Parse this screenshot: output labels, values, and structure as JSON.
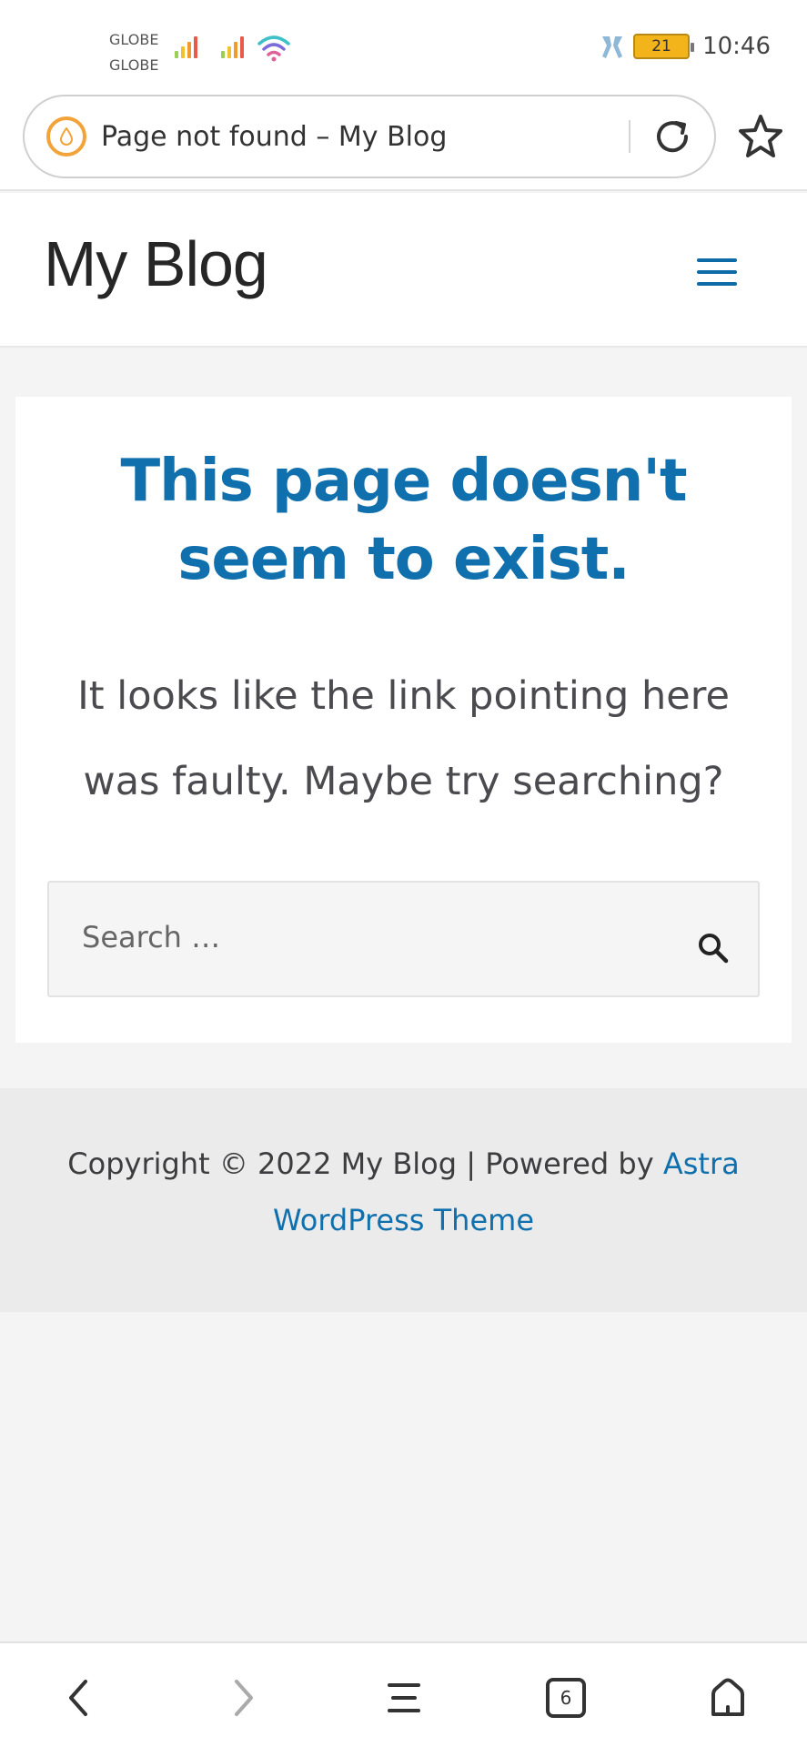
{
  "status_bar": {
    "carrier1": "GLOBE",
    "carrier2": "GLOBE",
    "battery": "21",
    "time": "10:46"
  },
  "browser": {
    "url_title": "Page not found – My Blog",
    "icons": {
      "site": "droplet-icon",
      "reload": "reload-icon",
      "bookmark": "star-icon"
    }
  },
  "site": {
    "title": "My Blog",
    "menu_icon": "hamburger-menu-icon",
    "accent_color": "#1070ad"
  },
  "content": {
    "heading": "This page doesn't seem to exist.",
    "description": "It looks like the link pointing here was faulty. Maybe try searching?",
    "search_placeholder": "Search …",
    "search_icon": "search-icon"
  },
  "footer": {
    "prefix": "Copyright © 2022 My Blog | Powered by ",
    "link": "Astra WordPress Theme"
  },
  "bottom_nav": {
    "back": "back-icon",
    "forward": "forward-icon",
    "menu": "menu-icon",
    "tabs_count": "6",
    "home": "home-icon"
  }
}
